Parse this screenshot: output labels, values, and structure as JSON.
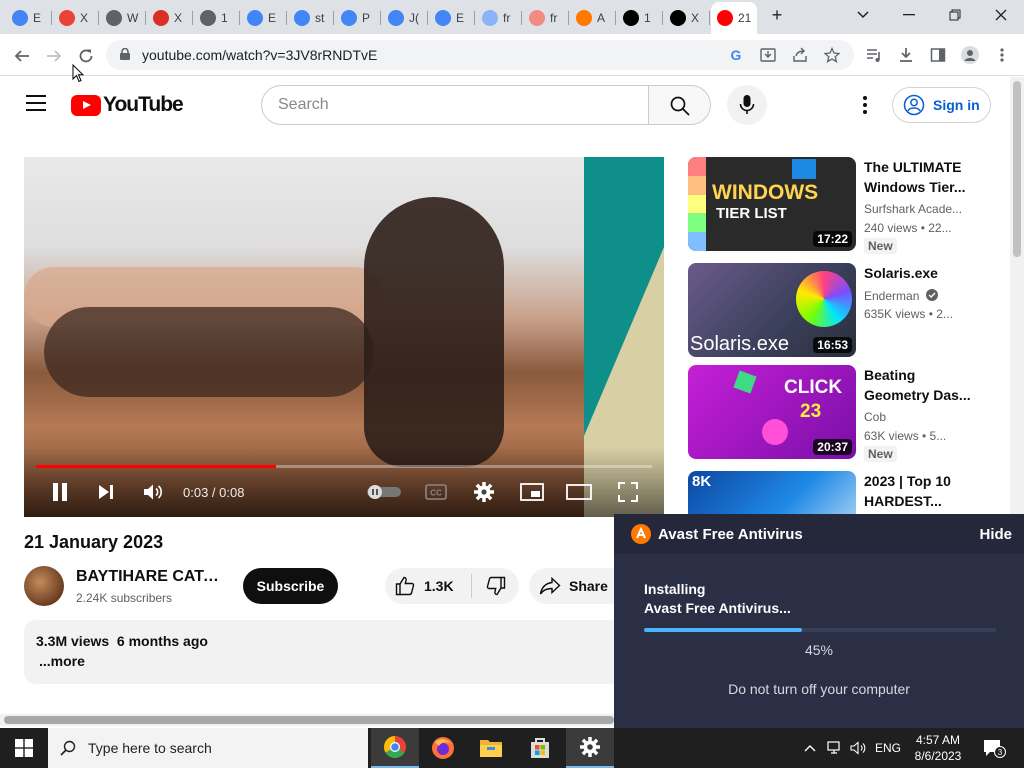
{
  "browser": {
    "tabs": [
      {
        "label": "E",
        "favicon": "google-icon",
        "color": "#4285f4"
      },
      {
        "label": "X",
        "favicon": "calendar-icon",
        "color": "#ea4335"
      },
      {
        "label": "W",
        "favicon": "globe-icon",
        "color": "#5f6368"
      },
      {
        "label": "X",
        "favicon": "tomato-icon",
        "color": "#d93025"
      },
      {
        "label": "1",
        "favicon": "globe-icon",
        "color": "#5f6368"
      },
      {
        "label": "E",
        "favicon": "google-icon",
        "color": "#4285f4"
      },
      {
        "label": "st",
        "favicon": "google-icon",
        "color": "#4285f4"
      },
      {
        "label": "P",
        "favicon": "google-icon",
        "color": "#4285f4"
      },
      {
        "label": "J(",
        "favicon": "google-icon",
        "color": "#4285f4"
      },
      {
        "label": "E",
        "favicon": "google-icon",
        "color": "#4285f4"
      },
      {
        "label": "fr",
        "favicon": "image-icon",
        "color": "#8ab4f8"
      },
      {
        "label": "fr",
        "favicon": "image-icon",
        "color": "#f28b82"
      },
      {
        "label": "A",
        "favicon": "avast-icon",
        "color": "#ff7800"
      },
      {
        "label": "1",
        "favicon": "tw-icon",
        "color": "#000000"
      },
      {
        "label": "X",
        "favicon": "wikipedia-icon",
        "color": "#000000"
      },
      {
        "label": "21",
        "favicon": "youtube-icon",
        "color": "#ff0000",
        "active": true
      }
    ],
    "url": "youtube.com/watch?v=3JV8rRNDTvE"
  },
  "youtube": {
    "logo_text": "YouTube",
    "search_placeholder": "Search",
    "sign_in": "Sign in",
    "player": {
      "current_time": "0:03",
      "duration": "0:08",
      "time_display": "0:03 / 0:08",
      "progress_fraction": 0.39
    },
    "video_title": "21 January 2023",
    "channel_name": "BAYTIHARE CATA...",
    "subscribers": "2.24K subscribers",
    "subscribe_label": "Subscribe",
    "likes": "1.3K",
    "share_label": "Share",
    "views_and_date": "3.3M views  6 months ago",
    "more_label": "...more",
    "recommendations": [
      {
        "title": "The ULTIMATE Windows Tier...",
        "channel": "Surfshark Acade...",
        "stats": "240 views  • 22...",
        "badge": "New",
        "duration": "17:22",
        "thumb_text": "WINDOWS TIER LIST"
      },
      {
        "title": "Solaris.exe",
        "channel": "Enderman",
        "stats": "635K views  • 2...",
        "badge": "",
        "duration": "16:53",
        "thumb_text": "Solaris.exe"
      },
      {
        "title": "Beating Geometry Das...",
        "channel": "Cob",
        "stats": "63K views  • 5...",
        "badge": "New",
        "duration": "20:37",
        "thumb_text": "CLICK 23"
      },
      {
        "title": "2023 | Top 10 HARDEST...",
        "channel": "",
        "stats": "",
        "badge": "",
        "duration": "",
        "thumb_text": "8K"
      }
    ]
  },
  "avast": {
    "title": "Avast Free Antivirus",
    "hide_label": "Hide",
    "status_line1": "Installing",
    "status_line2": "Avast Free Antivirus...",
    "percent_text": "45%",
    "progress_fraction": 0.45,
    "warning": "Do not turn off your computer"
  },
  "taskbar": {
    "search_placeholder": "Type here to search",
    "language": "ENG",
    "time": "4:57 AM",
    "date": "8/6/2023",
    "notification_count": "3"
  }
}
